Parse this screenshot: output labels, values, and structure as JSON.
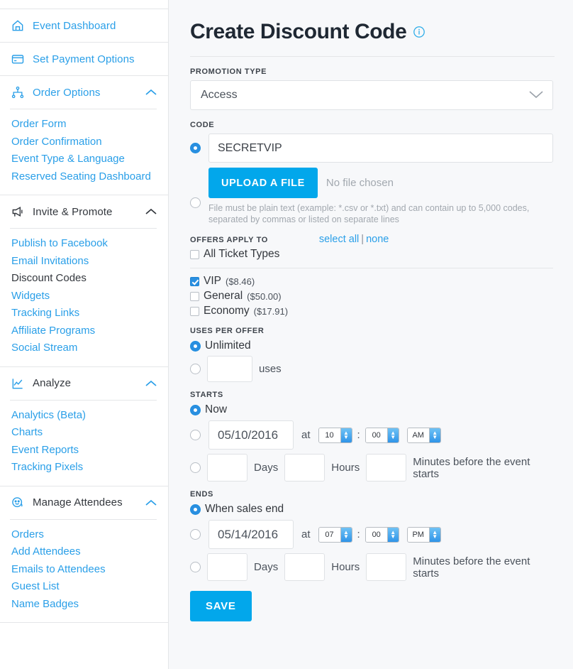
{
  "sidebar": {
    "sections": [
      {
        "id": "event-dashboard",
        "icon": "home-icon",
        "label": "Event Dashboard",
        "style": "link",
        "collapsible": false,
        "links": []
      },
      {
        "id": "set-payment-options",
        "icon": "credit-card-icon",
        "label": "Set Payment Options",
        "style": "link",
        "collapsible": false,
        "links": []
      },
      {
        "id": "order-options",
        "icon": "sitemap-icon",
        "label": "Order Options",
        "style": "link",
        "collapsible": true,
        "links": [
          {
            "label": "Order Form",
            "active": false
          },
          {
            "label": "Order Confirmation",
            "active": false
          },
          {
            "label": "Event Type & Language",
            "active": false
          },
          {
            "label": "Reserved Seating Dashboard",
            "active": false
          }
        ]
      },
      {
        "id": "invite-and-promote",
        "icon": "megaphone-icon",
        "label": "Invite & Promote",
        "style": "dark",
        "collapsible": true,
        "links": [
          {
            "label": "Publish to Facebook",
            "active": false
          },
          {
            "label": "Email Invitations",
            "active": false
          },
          {
            "label": "Discount Codes",
            "active": true
          },
          {
            "label": "Widgets",
            "active": false
          },
          {
            "label": "Tracking Links",
            "active": false
          },
          {
            "label": "Affiliate Programs",
            "active": false
          },
          {
            "label": "Social Stream",
            "active": false
          }
        ]
      },
      {
        "id": "analyze",
        "icon": "chart-line-icon",
        "label": "Analyze",
        "style": "dark",
        "collapsible": true,
        "links": [
          {
            "label": "Analytics (Beta)",
            "active": false
          },
          {
            "label": "Charts",
            "active": false
          },
          {
            "label": "Event Reports",
            "active": false
          },
          {
            "label": "Tracking Pixels",
            "active": false
          }
        ]
      },
      {
        "id": "manage-attendees",
        "icon": "smiley-face-icon",
        "label": "Manage Attendees",
        "style": "dark",
        "collapsible": true,
        "links": [
          {
            "label": "Orders",
            "active": false
          },
          {
            "label": "Add Attendees",
            "active": false
          },
          {
            "label": "Emails to Attendees",
            "active": false
          },
          {
            "label": "Guest List",
            "active": false
          },
          {
            "label": "Name Badges",
            "active": false
          }
        ]
      }
    ]
  },
  "main": {
    "title": "Create Discount Code",
    "info_icon": "info-circle-icon",
    "promotion_type": {
      "label": "PROMOTION TYPE",
      "value": "Access",
      "chevron": "chevron-down-icon"
    },
    "code": {
      "label": "CODE",
      "value": "SECRETVIP",
      "manual_selected": true,
      "upload_selected": false,
      "upload_button": "UPLOAD A FILE",
      "no_file_text": "No file chosen",
      "help_text": "File must be plain text (example: *.csv or *.txt) and can contain up to 5,000 codes, separated by commas or listed on separate lines"
    },
    "offers": {
      "label": "OFFERS APPLY TO",
      "select_all": "select all",
      "separator": "|",
      "none": "none",
      "all_ticket_types": {
        "label": "All Ticket Types",
        "checked": false
      },
      "ticket_types": [
        {
          "name": "VIP",
          "price": "($8.46)",
          "checked": true
        },
        {
          "name": "General",
          "price": "($50.00)",
          "checked": false
        },
        {
          "name": "Economy",
          "price": "($17.91)",
          "checked": false
        }
      ]
    },
    "uses_per_offer": {
      "label": "USES PER OFFER",
      "unlimited_label": "Unlimited",
      "unlimited_selected": true,
      "custom_selected": false,
      "custom_value": "",
      "uses_text": "uses"
    },
    "starts": {
      "label": "STARTS",
      "now_label": "Now",
      "now_selected": true,
      "date_selected": false,
      "date": "05/10/2016",
      "at_text": "at",
      "hour": "10",
      "colon": ":",
      "minute": "00",
      "meridiem": "AM",
      "offset_selected": false,
      "days_value": "",
      "days_text": "Days",
      "hours_value": "",
      "hours_text": "Hours",
      "minutes_value": "",
      "minutes_text": "Minutes before the event starts"
    },
    "ends": {
      "label": "ENDS",
      "when_sales_end_label": "When sales end",
      "when_sales_end_selected": true,
      "date_selected": false,
      "date": "05/14/2016",
      "at_text": "at",
      "hour": "07",
      "colon": ":",
      "minute": "00",
      "meridiem": "PM",
      "offset_selected": false,
      "days_value": "",
      "days_text": "Days",
      "hours_value": "",
      "hours_text": "Hours",
      "minutes_value": "",
      "minutes_text": "Minutes before the event starts"
    },
    "save_button": "SAVE"
  },
  "colors": {
    "accent_blue": "#02a7eb",
    "link_blue": "#2a9fe8",
    "radio_blue": "#2a8fe0",
    "page_bg": "#f7f8fa",
    "sidebar_bg": "#ffffff",
    "border": "#e4e6e8",
    "muted_text": "#a2a8af"
  }
}
